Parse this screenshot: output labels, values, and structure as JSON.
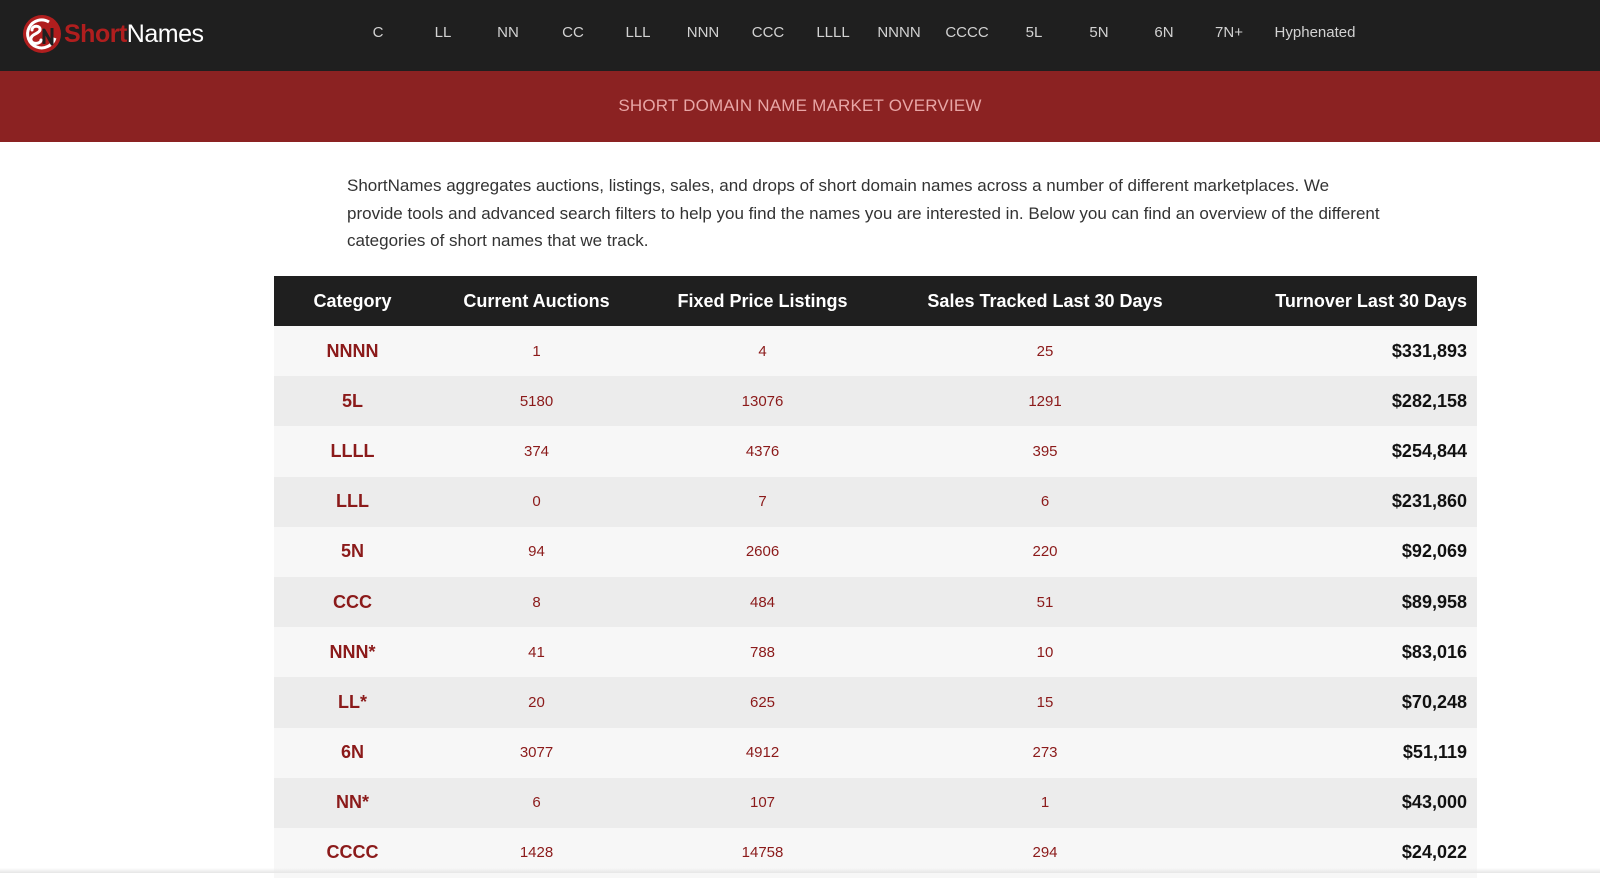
{
  "brand": {
    "name_part1": "Short",
    "name_part2": "Names",
    "logo_icon": "sn-logo-icon",
    "colors": {
      "topbar": "#1f1f1f",
      "banner": "#8b2222",
      "accent": "#8b1a1a"
    }
  },
  "nav": {
    "items": [
      "C",
      "LL",
      "NN",
      "CC",
      "LLL",
      "NNN",
      "CCC",
      "LLLL",
      "NNNN",
      "CCCC",
      "5L",
      "5N",
      "6N",
      "7N+",
      "Hyphenated"
    ]
  },
  "banner": {
    "title": "SHORT DOMAIN NAME MARKET OVERVIEW"
  },
  "intro": {
    "text": "ShortNames aggregates auctions, listings, sales, and drops of short domain names across a number of different marketplaces. We provide tools and advanced search filters to help you find the names you are interested in. Below you can find an overview of the different categories of short names that we track."
  },
  "table": {
    "headers": [
      "Category",
      "Current Auctions",
      "Fixed Price Listings",
      "Sales Tracked Last 30 Days",
      "Turnover Last 30 Days"
    ],
    "rows": [
      [
        "NNNN",
        "1",
        "4",
        "25",
        "$331,893"
      ],
      [
        "5L",
        "5180",
        "13076",
        "1291",
        "$282,158"
      ],
      [
        "LLLL",
        "374",
        "4376",
        "395",
        "$254,844"
      ],
      [
        "LLL",
        "0",
        "7",
        "6",
        "$231,860"
      ],
      [
        "5N",
        "94",
        "2606",
        "220",
        "$92,069"
      ],
      [
        "CCC",
        "8",
        "484",
        "51",
        "$89,958"
      ],
      [
        "NNN*",
        "41",
        "788",
        "10",
        "$83,016"
      ],
      [
        "LL*",
        "20",
        "625",
        "15",
        "$70,248"
      ],
      [
        "6N",
        "3077",
        "4912",
        "273",
        "$51,119"
      ],
      [
        "NN*",
        "6",
        "107",
        "1",
        "$43,000"
      ],
      [
        "CCCC",
        "1428",
        "14758",
        "294",
        "$24,022"
      ]
    ]
  }
}
